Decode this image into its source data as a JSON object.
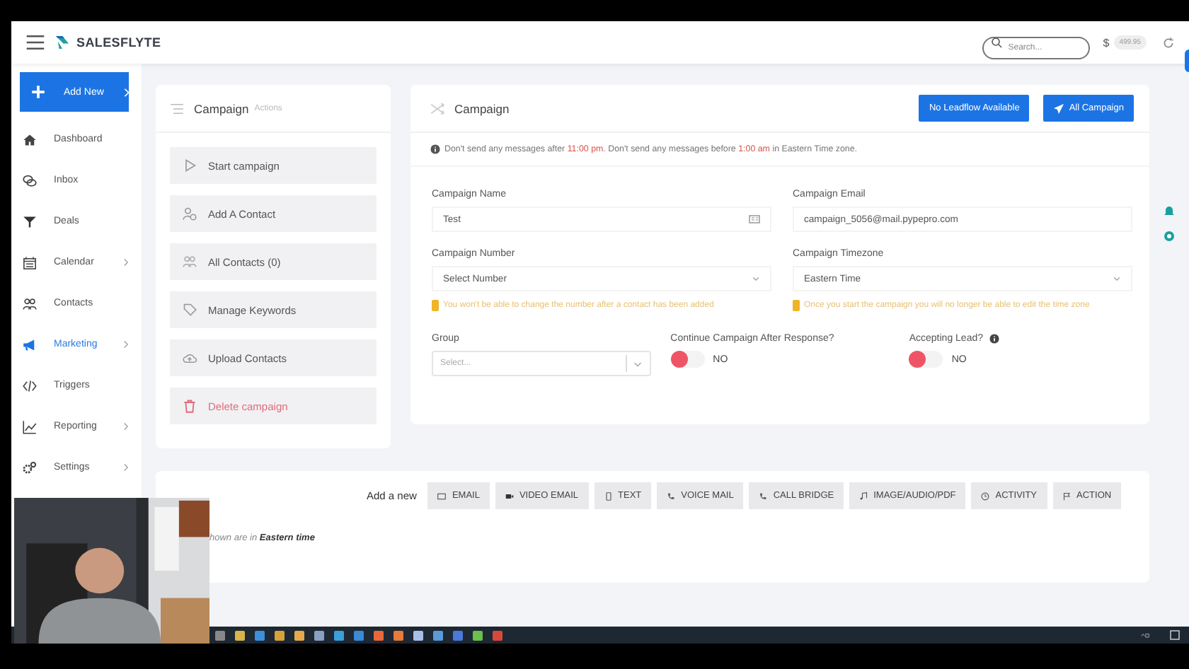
{
  "header": {
    "brand": "SALESFLYTE",
    "search": {
      "placeholder": "Search..."
    },
    "currency": "$",
    "balance": "499.95"
  },
  "sidebar": {
    "add_button": "Add New",
    "items": [
      {
        "label": "Dashboard",
        "has_submenu": false,
        "selected": false
      },
      {
        "label": "Inbox",
        "has_submenu": false,
        "selected": false
      },
      {
        "label": "Deals",
        "has_submenu": false,
        "selected": false
      },
      {
        "label": "Calendar",
        "has_submenu": true,
        "selected": false
      },
      {
        "label": "Contacts",
        "has_submenu": false,
        "selected": false
      },
      {
        "label": "Marketing",
        "has_submenu": true,
        "selected": true
      },
      {
        "label": "Triggers",
        "has_submenu": false,
        "selected": false
      },
      {
        "label": "Reporting",
        "has_submenu": true,
        "selected": false
      },
      {
        "label": "Settings",
        "has_submenu": true,
        "selected": false
      }
    ]
  },
  "actions_panel": {
    "title": "Campaign",
    "subtitle": "Actions",
    "actions": [
      {
        "label": "Start campaign",
        "kind": "normal"
      },
      {
        "label": "Add A Contact",
        "kind": "normal"
      },
      {
        "label": "All Contacts (0)",
        "kind": "normal"
      },
      {
        "label": "Manage Keywords",
        "kind": "normal"
      },
      {
        "label": "Upload Contacts",
        "kind": "normal"
      },
      {
        "label": "Delete campaign",
        "kind": "danger"
      }
    ]
  },
  "campaign": {
    "title": "Campaign",
    "buttons": [
      "No Leadflow Available",
      "All Campaign"
    ],
    "notice": [
      {
        "text": "Don't send any messages after ",
        "highlight": false
      },
      {
        "text": "11:00 pm",
        "highlight": true
      },
      {
        "text": ". Don't send any messages before ",
        "highlight": false
      },
      {
        "text": "1:00 am",
        "highlight": true
      },
      {
        "text": " in Eastern Time zone.",
        "highlight": false
      }
    ],
    "name": {
      "label": "Campaign Name",
      "value": "Test"
    },
    "email": {
      "label": "Campaign Email",
      "value": "campaign_5056@mail.pypepro.com"
    },
    "number": {
      "label": "Campaign Number",
      "value": "Select Number",
      "warning": "You won't be able to change the number after a contact has been added"
    },
    "timezone": {
      "label": "Campaign Timezone",
      "value": "Eastern Time",
      "warning": "Once you start the campaign you will no longer be able to edit the time zone"
    },
    "group": {
      "label": "Group",
      "placeholder": "Select..."
    },
    "toggles": [
      {
        "label": "Continue Campaign After Response?",
        "info": false,
        "on": false,
        "state_text": "NO"
      },
      {
        "label": "Accepting Lead?",
        "info": true,
        "on": false,
        "state_text": "NO"
      }
    ]
  },
  "steps": {
    "add_label": "Add a new",
    "buttons": [
      "EMAIL",
      "VIDEO EMAIL",
      "TEXT",
      "VOICE MAIL",
      "CALL BRIDGE",
      "IMAGE/AUDIO/PDF",
      "ACTIVITY",
      "ACTION"
    ],
    "note": "hown are in **Eastern time**"
  }
}
